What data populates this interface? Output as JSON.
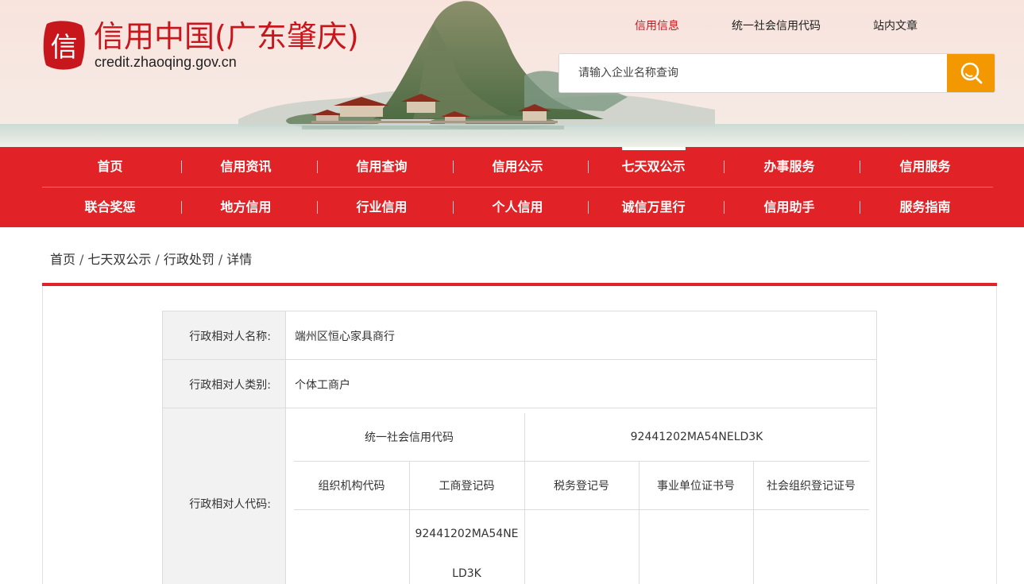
{
  "header": {
    "logo_char": "信",
    "site_title": "信用中国(广东肇庆)",
    "site_url": "credit.zhaoqing.gov.cn",
    "top_links": [
      {
        "label": "信用信息",
        "active": true
      },
      {
        "label": "统一社会信用代码",
        "active": false
      },
      {
        "label": "站内文章",
        "active": false
      }
    ],
    "search": {
      "placeholder": "请输入企业名称查询",
      "button_icon": "search-icon"
    }
  },
  "nav": {
    "row1": [
      {
        "label": "首页"
      },
      {
        "label": "信用资讯"
      },
      {
        "label": "信用查询"
      },
      {
        "label": "信用公示"
      },
      {
        "label": "七天双公示",
        "active": true
      },
      {
        "label": "办事服务"
      },
      {
        "label": "信用服务"
      }
    ],
    "row2": [
      {
        "label": "联合奖惩"
      },
      {
        "label": "地方信用"
      },
      {
        "label": "行业信用"
      },
      {
        "label": "个人信用"
      },
      {
        "label": "诚信万里行"
      },
      {
        "label": "信用助手"
      },
      {
        "label": "服务指南"
      }
    ]
  },
  "breadcrumb": {
    "items": [
      "首页",
      "七天双公示",
      "行政处罚",
      "详情"
    ],
    "separator": "/"
  },
  "detail": {
    "rows": [
      {
        "label": "行政相对人名称:",
        "value": "端州区恒心家具商行"
      },
      {
        "label": "行政相对人类别:",
        "value": "个体工商户"
      },
      {
        "label": "行政相对人代码:"
      }
    ],
    "codes": {
      "credit_code_label": "统一社会信用代码",
      "credit_code_value": "92441202MA54NELD3K",
      "columns": [
        "组织机构代码",
        "工商登记码",
        "税务登记号",
        "事业单位证书号",
        "社会组织登记证号"
      ],
      "org_code": "",
      "business_reg_line1": "92441202MA54NE",
      "business_reg_line2": "LD3K",
      "tax_reg": "",
      "institution_cert": "",
      "social_org_cert": ""
    }
  },
  "colors": {
    "brand_red": "#e12226",
    "title_red": "#c8161d",
    "search_orange": "#f39800",
    "label_bg": "#f2f2f2"
  }
}
